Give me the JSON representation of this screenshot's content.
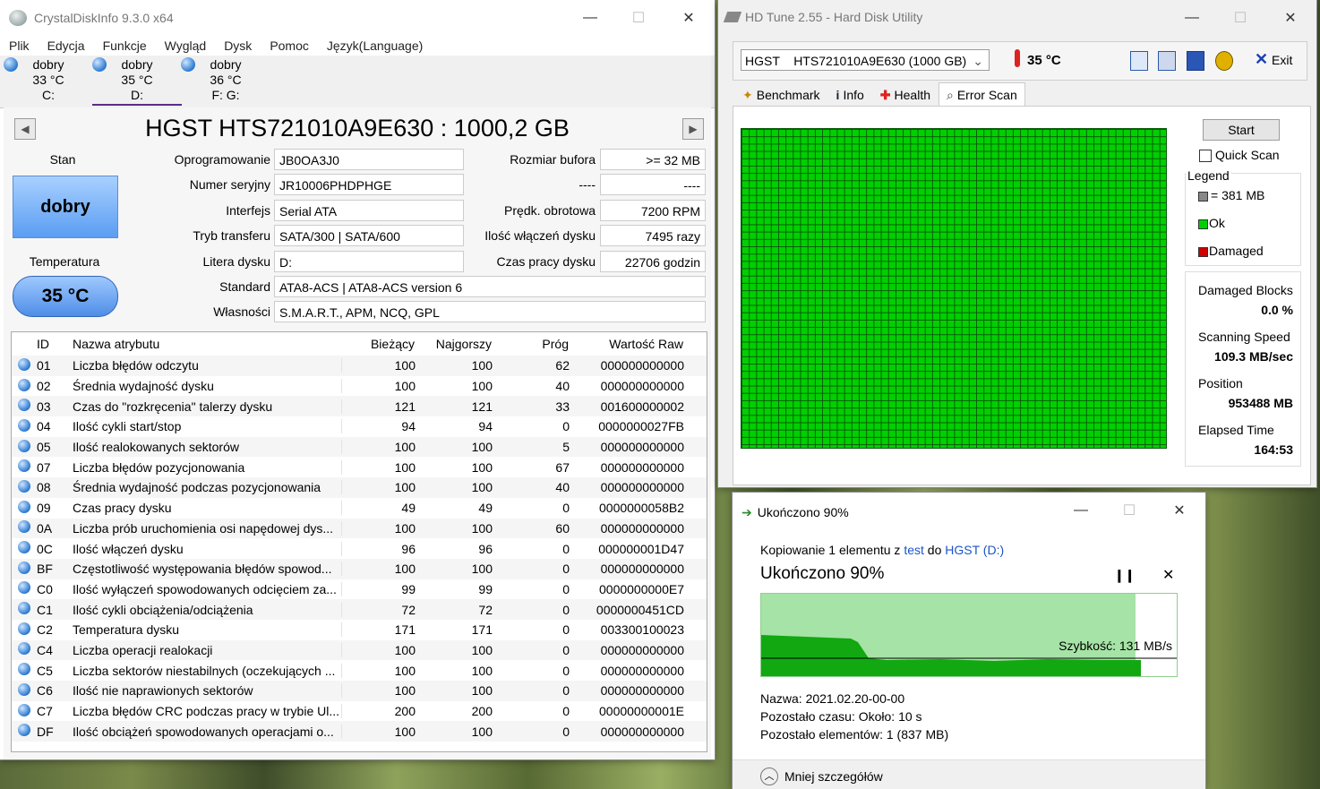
{
  "cdi": {
    "title": "CrystalDiskInfo 9.3.0 x64",
    "menu": [
      "Plik",
      "Edycja",
      "Funkcje",
      "Wygląd",
      "Dysk",
      "Pomoc",
      "Język(Language)"
    ],
    "drives": [
      {
        "status": "dobry",
        "temp": "33 °C",
        "letter": "C:"
      },
      {
        "status": "dobry",
        "temp": "35 °C",
        "letter": "D:"
      },
      {
        "status": "dobry",
        "temp": "36 °C",
        "letter": "F: G:"
      }
    ],
    "model": "HGST HTS721010A9E630 : 1000,2 GB",
    "stan_label": "Stan",
    "stan_value": "dobry",
    "temp_label": "Temperatura",
    "temp_value": "35 °C",
    "fields": {
      "firmware_label": "Oprogramowanie",
      "firmware": "JB0OA3J0",
      "serial_label": "Numer seryjny",
      "serial": "JR10006PHDPHGE",
      "interface_label": "Interfejs",
      "interface": "Serial ATA",
      "transfer_label": "Tryb transferu",
      "transfer": "SATA/300 | SATA/600",
      "letter_label": "Litera dysku",
      "letter": "D:",
      "standard_label": "Standard",
      "standard": "ATA8-ACS | ATA8-ACS version 6",
      "features_label": "Własności",
      "features": "S.M.A.R.T., APM, NCQ, GPL",
      "buffer_label": "Rozmiar bufora",
      "buffer": ">= 32 MB",
      "blank_label": "----",
      "blank": "----",
      "rpm_label": "Prędk. obrotowa",
      "rpm": "7200 RPM",
      "power_count_label": "Ilość włączeń dysku",
      "power_count": "7495 razy",
      "hours_label": "Czas pracy dysku",
      "hours": "22706 godzin"
    },
    "table": {
      "headers": [
        "ID",
        "Nazwa atrybutu",
        "Bieżący",
        "Najgorszy",
        "Próg",
        "Wartość Raw"
      ],
      "rows": [
        [
          "01",
          "Liczba błędów odczytu",
          "100",
          "100",
          "62",
          "000000000000"
        ],
        [
          "02",
          "Średnia wydajność dysku",
          "100",
          "100",
          "40",
          "000000000000"
        ],
        [
          "03",
          "Czas do \"rozkręcenia\" talerzy dysku",
          "121",
          "121",
          "33",
          "001600000002"
        ],
        [
          "04",
          "Ilość cykli start/stop",
          "94",
          "94",
          "0",
          "0000000027FB"
        ],
        [
          "05",
          "Ilość realokowanych sektorów",
          "100",
          "100",
          "5",
          "000000000000"
        ],
        [
          "07",
          "Liczba błędów pozycjonowania",
          "100",
          "100",
          "67",
          "000000000000"
        ],
        [
          "08",
          "Średnia wydajność podczas pozycjonowania",
          "100",
          "100",
          "40",
          "000000000000"
        ],
        [
          "09",
          "Czas pracy dysku",
          "49",
          "49",
          "0",
          "0000000058B2"
        ],
        [
          "0A",
          "Liczba prób uruchomienia osi napędowej dys...",
          "100",
          "100",
          "60",
          "000000000000"
        ],
        [
          "0C",
          "Ilość włączeń dysku",
          "96",
          "96",
          "0",
          "000000001D47"
        ],
        [
          "BF",
          "Częstotliwość występowania błędów spowod...",
          "100",
          "100",
          "0",
          "000000000000"
        ],
        [
          "C0",
          "Ilość wyłączeń spowodowanych odcięciem za...",
          "99",
          "99",
          "0",
          "0000000000E7"
        ],
        [
          "C1",
          "Ilość cykli obciążenia/odciążenia",
          "72",
          "72",
          "0",
          "0000000451CD"
        ],
        [
          "C2",
          "Temperatura dysku",
          "171",
          "171",
          "0",
          "003300100023"
        ],
        [
          "C4",
          "Liczba operacji realokacji",
          "100",
          "100",
          "0",
          "000000000000"
        ],
        [
          "C5",
          "Liczba sektorów niestabilnych (oczekujących ...",
          "100",
          "100",
          "0",
          "000000000000"
        ],
        [
          "C6",
          "Ilość nie naprawionych sektorów",
          "100",
          "100",
          "0",
          "000000000000"
        ],
        [
          "C7",
          "Liczba błędów CRC podczas pracy w trybie Ul...",
          "200",
          "200",
          "0",
          "00000000001E"
        ],
        [
          "DF",
          "Ilość obciążeń spowodowanych operacjami o...",
          "100",
          "100",
          "0",
          "000000000000"
        ]
      ]
    }
  },
  "hdtune": {
    "title": "HD Tune 2.55 - Hard Disk Utility",
    "drive": "HGST    HTS721010A9E630 (1000 GB)",
    "temp": "35 °C",
    "exit_label": "Exit",
    "tabs": [
      "Benchmark",
      "Info",
      "Health",
      "Error Scan"
    ],
    "start_label": "Start",
    "quick_scan_label": "Quick Scan",
    "legend_title": "Legend",
    "legend_block": "= 381 MB",
    "legend_ok": "Ok",
    "legend_damaged": "Damaged",
    "damaged_blocks_label": "Damaged Blocks",
    "damaged_blocks": "0.0 %",
    "speed_label": "Scanning Speed",
    "speed": "109.3 MB/sec",
    "position_label": "Position",
    "position": "953488 MB",
    "elapsed_label": "Elapsed Time",
    "elapsed": "164:53",
    "colors": {
      "ok": "#00d000",
      "damaged": "#d00000"
    }
  },
  "copy": {
    "title": "Ukończono 90%",
    "copy_prefix": "Kopiowanie 1 elementu z ",
    "source": "test",
    "to": " do ",
    "dest": "HGST (D:)",
    "heading": "Ukończono 90%",
    "progress": 0.9,
    "speed": "Szybkość: 131 MB/s",
    "name_line": "Nazwa: 2021.02.20-00-00",
    "time_line": "Pozostało czasu: Około: 10 s",
    "items_line": "Pozostało elementów: 1 (837 MB)",
    "less_details": "Mniej szczegółów"
  }
}
